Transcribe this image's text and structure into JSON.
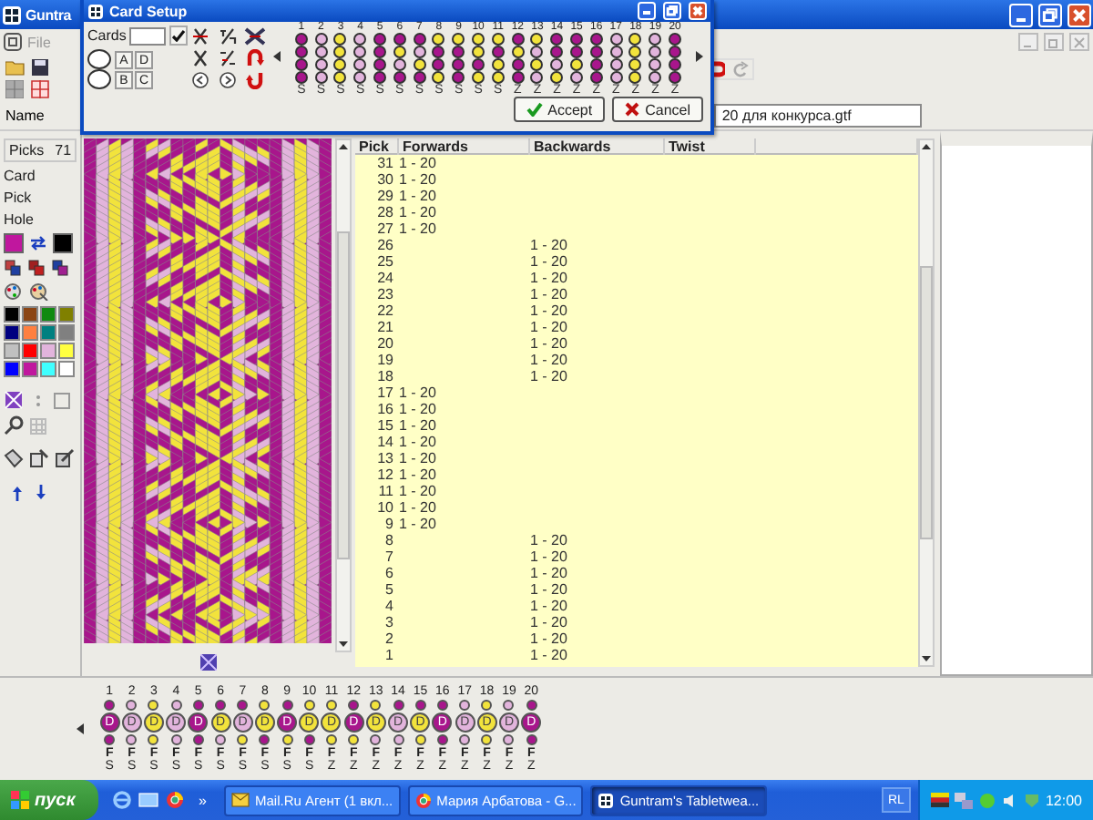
{
  "main_window": {
    "title": "Guntra",
    "menu": [
      "File"
    ],
    "name_label": "Name",
    "file_name": "20 для конкурса.gtf"
  },
  "card_setup": {
    "title": "Card Setup",
    "cards_label": "Cards",
    "hole_buttons": [
      "A",
      "D",
      "B",
      "C"
    ],
    "cards": [
      {
        "number": "1",
        "holes": [
          {
            "color": "#a8168c"
          },
          {
            "color": "#a8168c"
          },
          {
            "color": "#a8168c"
          },
          {
            "color": "#a8168c"
          }
        ],
        "twist": "S"
      },
      {
        "number": "2",
        "holes": [
          {
            "color": "#e2b4dc"
          },
          {
            "color": "#e2b4dc"
          },
          {
            "color": "#e2b4dc"
          },
          {
            "color": "#e2b4dc"
          }
        ],
        "twist": "S"
      },
      {
        "number": "3",
        "holes": [
          {
            "color": "#f2e33c"
          },
          {
            "color": "#f2e33c"
          },
          {
            "color": "#f2e33c"
          },
          {
            "color": "#f2e33c"
          }
        ],
        "twist": "S"
      },
      {
        "number": "4",
        "holes": [
          {
            "color": "#e2b4dc"
          },
          {
            "color": "#e2b4dc"
          },
          {
            "color": "#e2b4dc"
          },
          {
            "color": "#e2b4dc"
          }
        ],
        "twist": "S"
      },
      {
        "number": "5",
        "holes": [
          {
            "color": "#a8168c"
          },
          {
            "color": "#a8168c"
          },
          {
            "color": "#a8168c"
          },
          {
            "color": "#a8168c"
          }
        ],
        "twist": "S"
      },
      {
        "number": "6",
        "holes": [
          {
            "color": "#a8168c"
          },
          {
            "color": "#f2e33c"
          },
          {
            "color": "#e2b4dc"
          },
          {
            "color": "#a8168c"
          }
        ],
        "twist": "S"
      },
      {
        "number": "7",
        "holes": [
          {
            "color": "#a8168c"
          },
          {
            "color": "#e2b4dc"
          },
          {
            "color": "#f2e33c"
          },
          {
            "color": "#a8168c"
          }
        ],
        "twist": "S"
      },
      {
        "number": "8",
        "holes": [
          {
            "color": "#f2e33c"
          },
          {
            "color": "#a8168c"
          },
          {
            "color": "#a8168c"
          },
          {
            "color": "#f2e33c"
          }
        ],
        "twist": "S"
      },
      {
        "number": "9",
        "holes": [
          {
            "color": "#f2e33c"
          },
          {
            "color": "#a8168c"
          },
          {
            "color": "#a8168c"
          },
          {
            "color": "#a8168c"
          }
        ],
        "twist": "S"
      },
      {
        "number": "10",
        "holes": [
          {
            "color": "#f2e33c"
          },
          {
            "color": "#f2e33c"
          },
          {
            "color": "#a8168c"
          },
          {
            "color": "#f2e33c"
          }
        ],
        "twist": "S"
      },
      {
        "number": "11",
        "holes": [
          {
            "color": "#f2e33c"
          },
          {
            "color": "#a8168c"
          },
          {
            "color": "#f2e33c"
          },
          {
            "color": "#f2e33c"
          }
        ],
        "twist": "S"
      },
      {
        "number": "12",
        "holes": [
          {
            "color": "#a8168c"
          },
          {
            "color": "#f2e33c"
          },
          {
            "color": "#a8168c"
          },
          {
            "color": "#a8168c"
          }
        ],
        "twist": "Z"
      },
      {
        "number": "13",
        "holes": [
          {
            "color": "#f2e33c"
          },
          {
            "color": "#e2b4dc"
          },
          {
            "color": "#f2e33c"
          },
          {
            "color": "#e2b4dc"
          }
        ],
        "twist": "Z"
      },
      {
        "number": "14",
        "holes": [
          {
            "color": "#a8168c"
          },
          {
            "color": "#a8168c"
          },
          {
            "color": "#e2b4dc"
          },
          {
            "color": "#f2e33c"
          }
        ],
        "twist": "Z"
      },
      {
        "number": "15",
        "holes": [
          {
            "color": "#a8168c"
          },
          {
            "color": "#a8168c"
          },
          {
            "color": "#f2e33c"
          },
          {
            "color": "#e2b4dc"
          }
        ],
        "twist": "Z"
      },
      {
        "number": "16",
        "holes": [
          {
            "color": "#a8168c"
          },
          {
            "color": "#a8168c"
          },
          {
            "color": "#a8168c"
          },
          {
            "color": "#a8168c"
          }
        ],
        "twist": "Z"
      },
      {
        "number": "17",
        "holes": [
          {
            "color": "#e2b4dc"
          },
          {
            "color": "#e2b4dc"
          },
          {
            "color": "#e2b4dc"
          },
          {
            "color": "#e2b4dc"
          }
        ],
        "twist": "Z"
      },
      {
        "number": "18",
        "holes": [
          {
            "color": "#f2e33c"
          },
          {
            "color": "#f2e33c"
          },
          {
            "color": "#f2e33c"
          },
          {
            "color": "#f2e33c"
          }
        ],
        "twist": "Z"
      },
      {
        "number": "19",
        "holes": [
          {
            "color": "#e2b4dc"
          },
          {
            "color": "#e2b4dc"
          },
          {
            "color": "#e2b4dc"
          },
          {
            "color": "#e2b4dc"
          }
        ],
        "twist": "Z"
      },
      {
        "number": "20",
        "holes": [
          {
            "color": "#a8168c"
          },
          {
            "color": "#a8168c"
          },
          {
            "color": "#a8168c"
          },
          {
            "color": "#a8168c"
          }
        ],
        "twist": "Z"
      }
    ],
    "buttons": [
      {
        "kind": "accept",
        "label": "Accept"
      },
      {
        "kind": "cancel",
        "label": "Cancel"
      }
    ]
  },
  "left_panel": {
    "picks_label": "Picks",
    "picks": "71",
    "info": [
      "Card",
      "Pick",
      "Hole"
    ],
    "foreground": {
      "color": "#c0179e"
    },
    "background": {
      "color": "#000000"
    },
    "palette": [
      {
        "color": "#000000"
      },
      {
        "color": "#8b4513"
      },
      {
        "color": "#108a10"
      },
      {
        "color": "#808000"
      },
      {
        "color": "#000080"
      },
      {
        "color": "#ff8040"
      },
      {
        "color": "#008080"
      },
      {
        "color": "#808080"
      },
      {
        "color": "#c0c0c0"
      },
      {
        "color": "#ff0000"
      },
      {
        "color": "#e2b4dc"
      },
      {
        "color": "#ffff40"
      },
      {
        "color": "#0000ff"
      },
      {
        "color": "#c0179e"
      },
      {
        "color": "#40ffff"
      },
      {
        "color": "#ffffff"
      }
    ]
  },
  "pick_table": {
    "columns": [
      "Pick",
      "Forwards",
      "Backwards",
      "Twist"
    ],
    "rows": [
      {
        "pick": "31",
        "forwards": "1 - 20"
      },
      {
        "pick": "30",
        "forwards": "1 - 20"
      },
      {
        "pick": "29",
        "forwards": "1 - 20"
      },
      {
        "pick": "28",
        "forwards": "1 - 20"
      },
      {
        "pick": "27",
        "forwards": "1 - 20"
      },
      {
        "pick": "26",
        "backwards": "1 - 20"
      },
      {
        "pick": "25",
        "backwards": "1 - 20"
      },
      {
        "pick": "24",
        "backwards": "1 - 20"
      },
      {
        "pick": "23",
        "backwards": "1 - 20"
      },
      {
        "pick": "22",
        "backwards": "1 - 20"
      },
      {
        "pick": "21",
        "backwards": "1 - 20"
      },
      {
        "pick": "20",
        "backwards": "1 - 20"
      },
      {
        "pick": "19",
        "backwards": "1 - 20"
      },
      {
        "pick": "18",
        "backwards": "1 - 20"
      },
      {
        "pick": "17",
        "forwards": "1 - 20"
      },
      {
        "pick": "16",
        "forwards": "1 - 20"
      },
      {
        "pick": "15",
        "forwards": "1 - 20"
      },
      {
        "pick": "14",
        "forwards": "1 - 20"
      },
      {
        "pick": "13",
        "forwards": "1 - 20"
      },
      {
        "pick": "12",
        "forwards": "1 - 20"
      },
      {
        "pick": "11",
        "forwards": "1 - 20"
      },
      {
        "pick": "10",
        "forwards": "1 - 20"
      },
      {
        "pick": "9",
        "forwards": "1 - 20"
      },
      {
        "pick": "8",
        "backwards": "1 - 20"
      },
      {
        "pick": "7",
        "backwards": "1 - 20"
      },
      {
        "pick": "6",
        "backwards": "1 - 20"
      },
      {
        "pick": "5",
        "backwards": "1 - 20"
      },
      {
        "pick": "4",
        "backwards": "1 - 20"
      },
      {
        "pick": "3",
        "backwards": "1 - 20"
      },
      {
        "pick": "2",
        "backwards": "1 - 20"
      },
      {
        "pick": "1",
        "backwards": "1 - 20"
      }
    ]
  },
  "card_strip": [
    {
      "number": "1",
      "holes": [
        {
          "color": "#a8168c"
        },
        {
          "color": "#a8168c"
        },
        {
          "color": "#a8168c"
        }
      ],
      "hole": "D",
      "direction": "F",
      "twist": "S"
    },
    {
      "number": "2",
      "holes": [
        {
          "color": "#e2b4dc"
        },
        {
          "color": "#e2b4dc"
        },
        {
          "color": "#e2b4dc"
        }
      ],
      "hole": "D",
      "direction": "F",
      "twist": "S"
    },
    {
      "number": "3",
      "holes": [
        {
          "color": "#f2e33c"
        },
        {
          "color": "#f2e33c"
        },
        {
          "color": "#f2e33c"
        }
      ],
      "hole": "D",
      "direction": "F",
      "twist": "S"
    },
    {
      "number": "4",
      "holes": [
        {
          "color": "#e2b4dc"
        },
        {
          "color": "#e2b4dc"
        },
        {
          "color": "#e2b4dc"
        }
      ],
      "hole": "D",
      "direction": "F",
      "twist": "S"
    },
    {
      "number": "5",
      "holes": [
        {
          "color": "#a8168c"
        },
        {
          "color": "#a8168c"
        },
        {
          "color": "#a8168c"
        }
      ],
      "hole": "D",
      "direction": "F",
      "twist": "S"
    },
    {
      "number": "6",
      "holes": [
        {
          "color": "#a8168c"
        },
        {
          "color": "#f2e33c"
        },
        {
          "color": "#e2b4dc"
        }
      ],
      "hole": "D",
      "direction": "F",
      "twist": "S"
    },
    {
      "number": "7",
      "holes": [
        {
          "color": "#a8168c"
        },
        {
          "color": "#e2b4dc"
        },
        {
          "color": "#f2e33c"
        }
      ],
      "hole": "D",
      "direction": "F",
      "twist": "S"
    },
    {
      "number": "8",
      "holes": [
        {
          "color": "#f2e33c"
        },
        {
          "color": "#f2e33c"
        },
        {
          "color": "#a8168c"
        }
      ],
      "hole": "D",
      "direction": "F",
      "twist": "S"
    },
    {
      "number": "9",
      "holes": [
        {
          "color": "#a8168c"
        },
        {
          "color": "#a8168c"
        },
        {
          "color": "#f2e33c"
        }
      ],
      "hole": "D",
      "direction": "F",
      "twist": "S"
    },
    {
      "number": "10",
      "holes": [
        {
          "color": "#f2e33c"
        },
        {
          "color": "#f2e33c"
        },
        {
          "color": "#a8168c"
        }
      ],
      "hole": "D",
      "direction": "F",
      "twist": "S"
    },
    {
      "number": "11",
      "holes": [
        {
          "color": "#f2e33c"
        },
        {
          "color": "#f2e33c"
        },
        {
          "color": "#f2e33c"
        }
      ],
      "hole": "D",
      "direction": "F",
      "twist": "Z"
    },
    {
      "number": "12",
      "holes": [
        {
          "color": "#a8168c"
        },
        {
          "color": "#a8168c"
        },
        {
          "color": "#f2e33c"
        }
      ],
      "hole": "D",
      "direction": "F",
      "twist": "Z"
    },
    {
      "number": "13",
      "holes": [
        {
          "color": "#f2e33c"
        },
        {
          "color": "#f2e33c"
        },
        {
          "color": "#e2b4dc"
        }
      ],
      "hole": "D",
      "direction": "F",
      "twist": "Z"
    },
    {
      "number": "14",
      "holes": [
        {
          "color": "#a8168c"
        },
        {
          "color": "#e2b4dc"
        },
        {
          "color": "#e2b4dc"
        }
      ],
      "hole": "D",
      "direction": "F",
      "twist": "Z"
    },
    {
      "number": "15",
      "holes": [
        {
          "color": "#a8168c"
        },
        {
          "color": "#f2e33c"
        },
        {
          "color": "#f2e33c"
        }
      ],
      "hole": "D",
      "direction": "F",
      "twist": "Z"
    },
    {
      "number": "16",
      "holes": [
        {
          "color": "#a8168c"
        },
        {
          "color": "#a8168c"
        },
        {
          "color": "#a8168c"
        }
      ],
      "hole": "D",
      "direction": "F",
      "twist": "Z"
    },
    {
      "number": "17",
      "holes": [
        {
          "color": "#e2b4dc"
        },
        {
          "color": "#e2b4dc"
        },
        {
          "color": "#e2b4dc"
        }
      ],
      "hole": "D",
      "direction": "F",
      "twist": "Z"
    },
    {
      "number": "18",
      "holes": [
        {
          "color": "#f2e33c"
        },
        {
          "color": "#f2e33c"
        },
        {
          "color": "#f2e33c"
        }
      ],
      "hole": "D",
      "direction": "F",
      "twist": "Z"
    },
    {
      "number": "19",
      "holes": [
        {
          "color": "#e2b4dc"
        },
        {
          "color": "#e2b4dc"
        },
        {
          "color": "#e2b4dc"
        }
      ],
      "hole": "D",
      "direction": "F",
      "twist": "Z"
    },
    {
      "number": "20",
      "holes": [
        {
          "color": "#a8168c"
        },
        {
          "color": "#a8168c"
        },
        {
          "color": "#a8168c"
        }
      ],
      "hole": "D",
      "direction": "F",
      "twist": "Z"
    }
  ],
  "taskbar": {
    "start": "пуск",
    "overflow": "»",
    "tasks": [
      {
        "kind": "mail",
        "label": "Mail.Ru Агент (1 вкл...",
        "selected": false
      },
      {
        "kind": "browser",
        "label": "Мария Арбатова - G...",
        "selected": false
      },
      {
        "kind": "app",
        "label": "Guntram's Tabletwea...",
        "selected": true
      }
    ],
    "language": "RL",
    "clock": "12:00"
  }
}
